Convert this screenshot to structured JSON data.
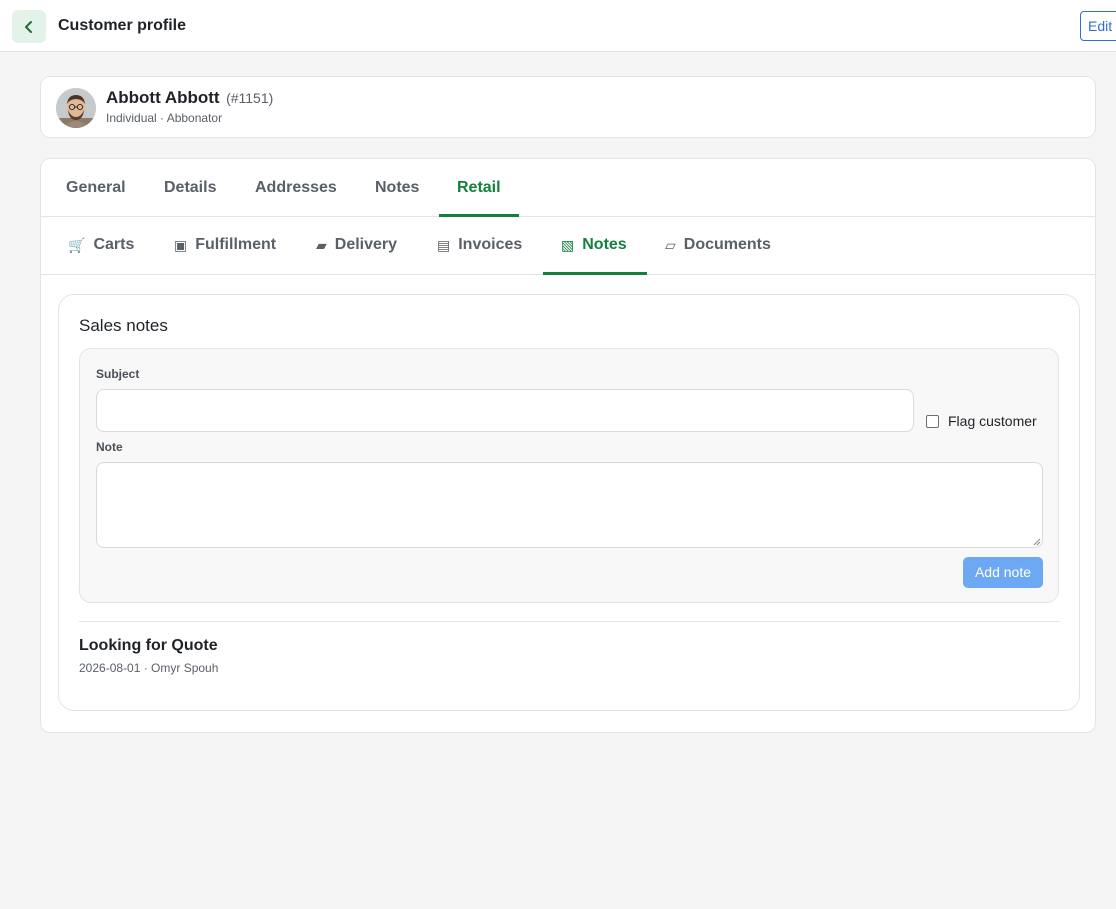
{
  "header": {
    "title": "Customer profile",
    "edit_label": "Edit"
  },
  "profile": {
    "name": "Abbott Abbott",
    "id": "(#1151)",
    "subtitle": "Individual · Abbonator"
  },
  "tabs_primary": [
    {
      "label": "General",
      "active": false
    },
    {
      "label": "Details",
      "active": false
    },
    {
      "label": "Addresses",
      "active": false
    },
    {
      "label": "Notes",
      "active": false
    },
    {
      "label": "Retail",
      "active": true
    }
  ],
  "tabs_secondary": [
    {
      "label": "Carts",
      "icon": "cart-icon",
      "glyph": "🛒",
      "active": false
    },
    {
      "label": "Fulfillment",
      "icon": "box-icon",
      "glyph": "▣",
      "active": false
    },
    {
      "label": "Delivery",
      "icon": "truck-icon",
      "glyph": "▰",
      "active": false
    },
    {
      "label": "Invoices",
      "icon": "invoice-icon",
      "glyph": "▤",
      "active": false
    },
    {
      "label": "Notes",
      "icon": "notes-icon",
      "glyph": "▧",
      "active": true
    },
    {
      "label": "Documents",
      "icon": "document-icon",
      "glyph": "▱",
      "active": false
    }
  ],
  "sales_notes": {
    "title": "Sales notes",
    "subject_label": "Subject",
    "subject_value": "",
    "flag_label": "Flag customer",
    "flag_checked": false,
    "note_label": "Note",
    "note_value": "",
    "add_label": "Add note",
    "entries": [
      {
        "title": "Looking for Quote",
        "meta": "2026-08-01 · Omyr Spouh"
      }
    ]
  },
  "colors": {
    "accent": "#15803d",
    "primary_button": "#6da8f4",
    "edit_button": "#2f6fd6"
  }
}
